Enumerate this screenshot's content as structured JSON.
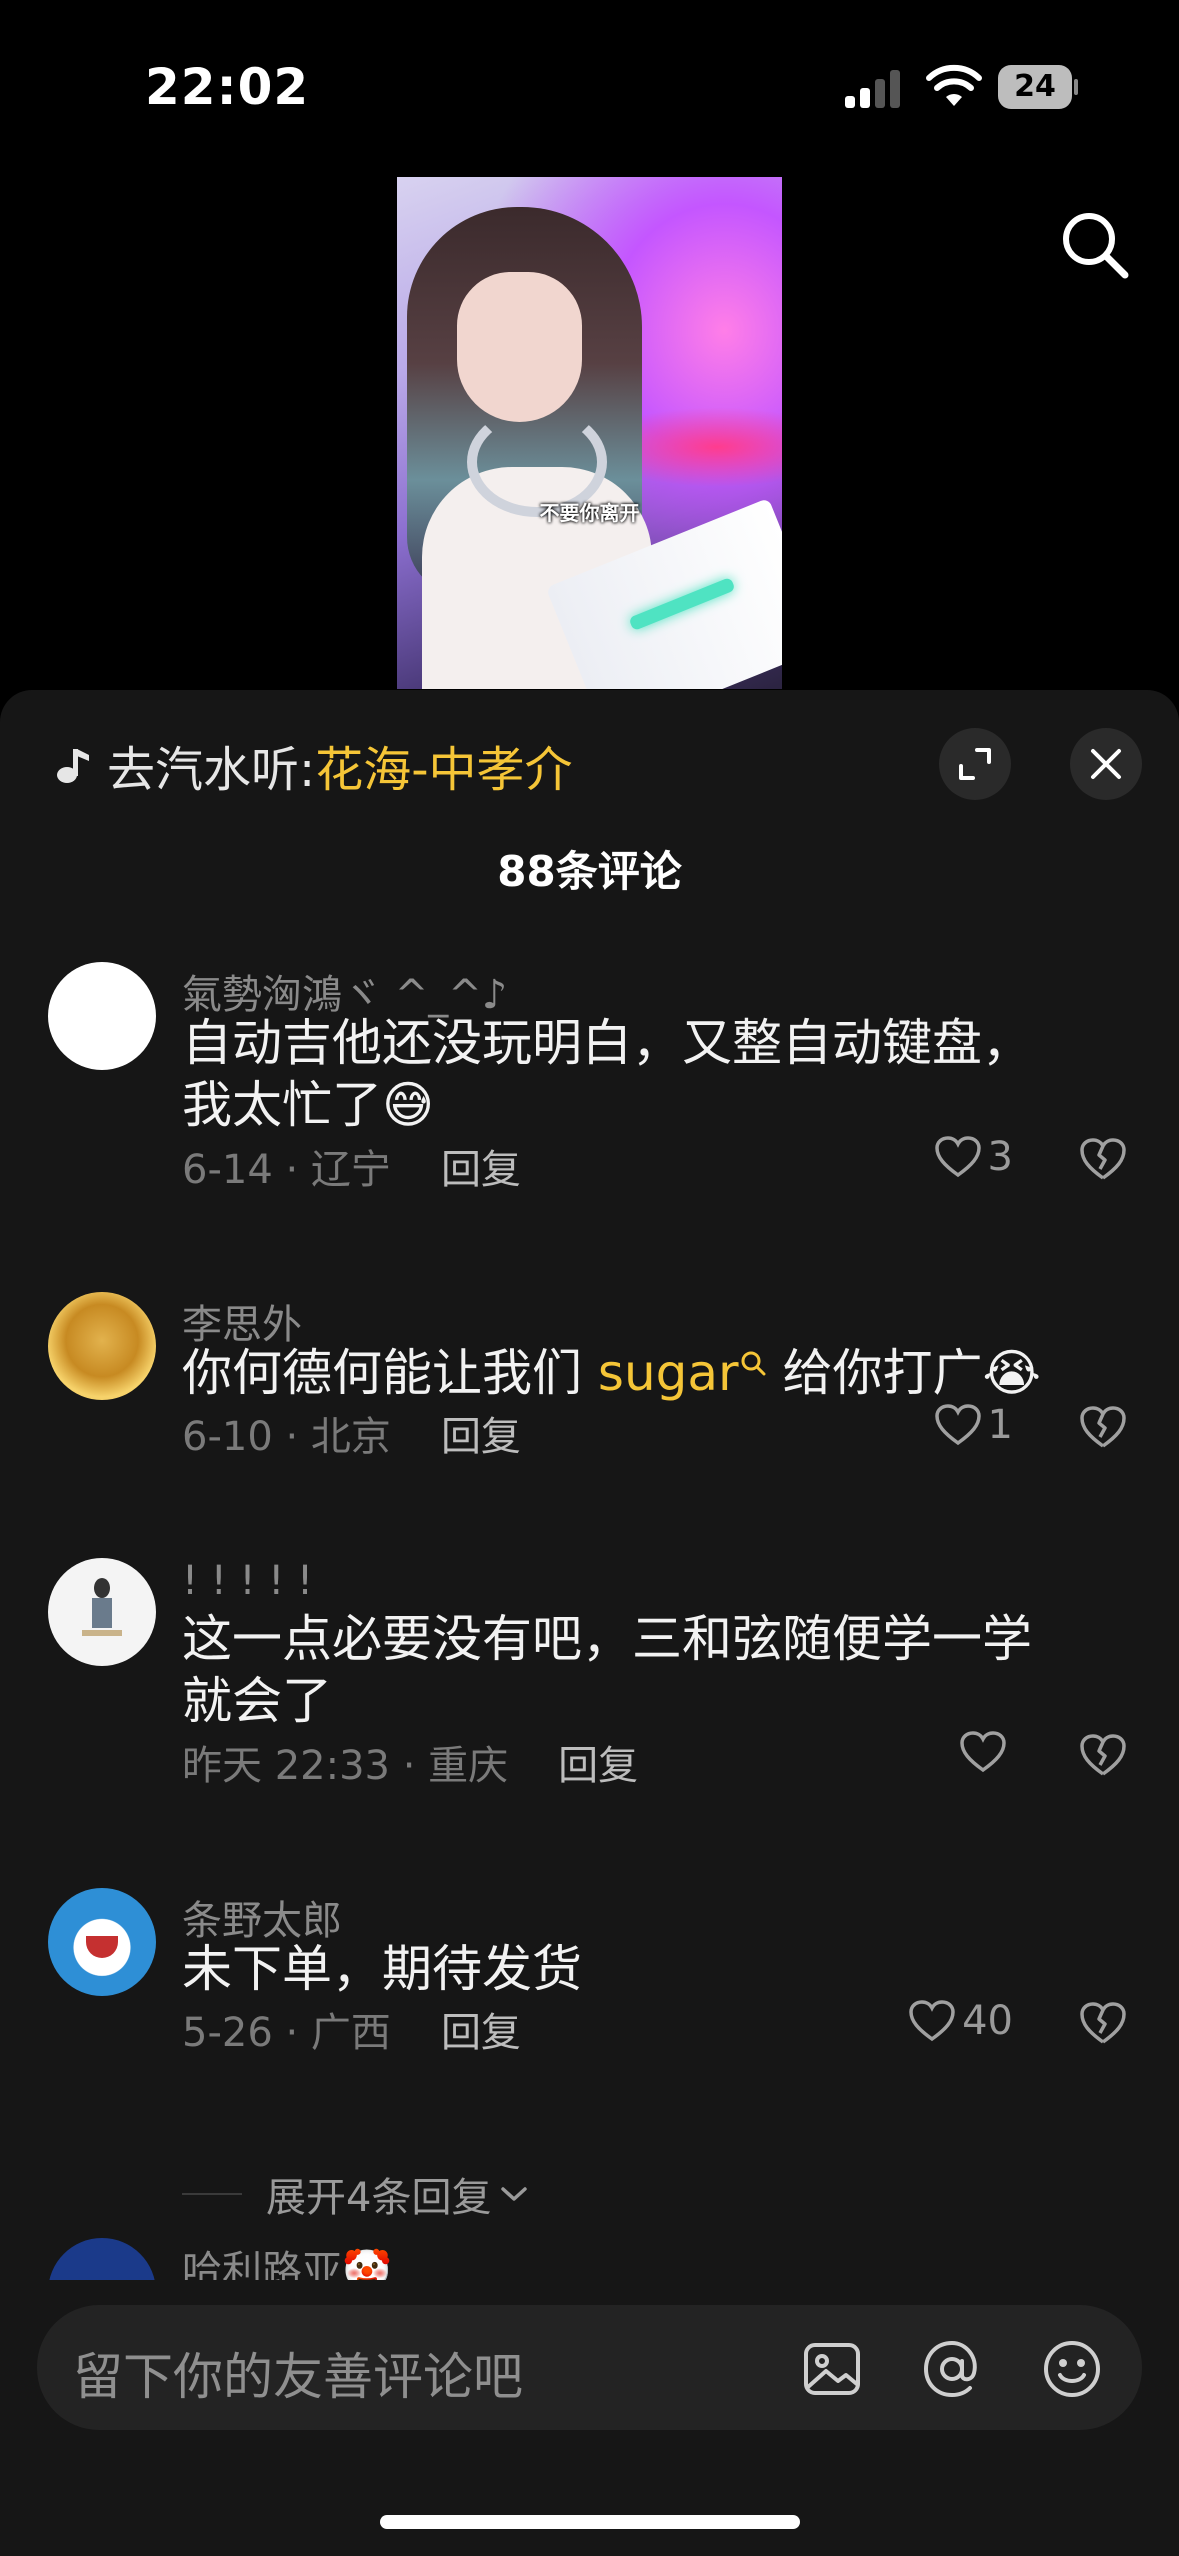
{
  "status_bar": {
    "time": "22:02",
    "battery": "24"
  },
  "video": {
    "caption": "不要你离开"
  },
  "sheet": {
    "music_prefix": "去汽水听:",
    "music_song": "花海-中孝介",
    "comment_count": "88条评论"
  },
  "comments": [
    {
      "username": "氣勢洶鴻ヾ ^_^♪",
      "text_line1": "自动吉他还没玩明白，又整自动键盘，",
      "text_line2": "我太忙了",
      "emoji": "😅",
      "date_location": "6-14 · 辽宁",
      "reply": "回复",
      "likes": "3"
    },
    {
      "username": "李思外",
      "text_before": "你何德何能让我们 ",
      "highlight": "sugar",
      "text_after": " 给你打广",
      "emoji": "😭",
      "date_location": "6-10 · 北京",
      "reply": "回复",
      "likes": "1"
    },
    {
      "username": "! ! ! ! !",
      "text_line1": "这一点必要没有吧，三和弦随便学一学",
      "text_line2": "就会了",
      "date_location": "昨天 22:33 · 重庆",
      "reply": "回复",
      "likes": ""
    },
    {
      "username": "条野太郎",
      "text_line1": "未下单，期待发货",
      "date_location": "5-26 · 广西",
      "reply": "回复",
      "likes": "40"
    },
    {
      "username": "哈利路亚",
      "emoji": "🤡"
    }
  ],
  "expand_replies": "展开4条回复",
  "input": {
    "placeholder": "留下你的友善评论吧"
  },
  "icons": [
    "search-icon",
    "music-note-icon",
    "expand-icon",
    "close-icon",
    "heart-icon",
    "broken-heart-icon",
    "image-icon",
    "at-icon",
    "emoji-icon",
    "chevron-down-icon"
  ]
}
